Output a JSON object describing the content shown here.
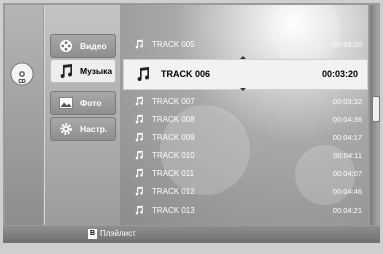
{
  "device": {
    "cd_label": "CD"
  },
  "menu": {
    "items": [
      {
        "label": "Видео",
        "icon": "film-reel-icon",
        "selected": false
      },
      {
        "label": "Музыка",
        "icon": "music-note-icon",
        "selected": true
      },
      {
        "label": "Фото",
        "icon": "photo-icon",
        "selected": false
      },
      {
        "label": "Настр.",
        "icon": "gear-icon",
        "selected": false
      }
    ]
  },
  "tracks": [
    {
      "title": "TRACK 005",
      "duration": "00:03:20"
    },
    {
      "title": "TRACK 006",
      "duration": "00:03:20",
      "selected": true
    },
    {
      "title": "TRACK 007",
      "duration": "00:03:32"
    },
    {
      "title": "TRACK 008",
      "duration": "00:04:36"
    },
    {
      "title": "TRACK 009",
      "duration": "00:04:17"
    },
    {
      "title": "TRACK 010",
      "duration": "00:04:11"
    },
    {
      "title": "TRACK 011",
      "duration": "00:04:07"
    },
    {
      "title": "TRACK 012",
      "duration": "00:04:46"
    },
    {
      "title": "TRACK 013",
      "duration": "00:04:21"
    }
  ],
  "footer": {
    "button": "B",
    "label": "Плэйлист"
  },
  "colors": {
    "selection_bg": "#f2f2f2",
    "panel_gray": "#9a9a9a",
    "hint_button": "#ffffff"
  }
}
